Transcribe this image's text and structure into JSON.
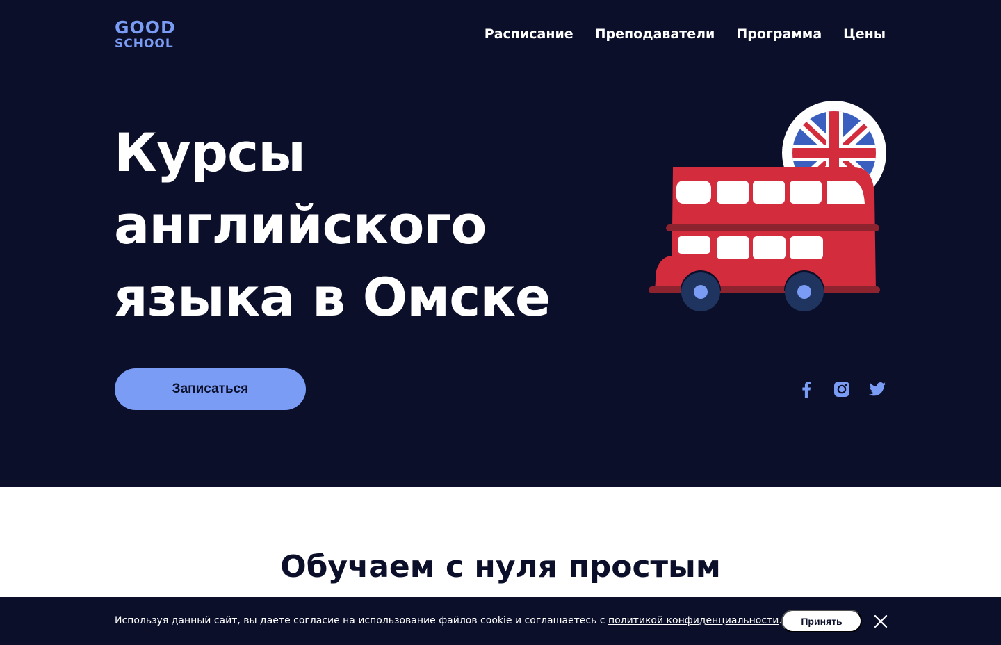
{
  "header": {
    "logo_line1": "GOOD",
    "logo_line2": "SCHOOL",
    "nav": [
      "Расписание",
      "Преподаватели",
      "Программа",
      "Цены"
    ]
  },
  "hero": {
    "title_lines": [
      "Курсы",
      "английского",
      "языка в Омске"
    ],
    "cta_label": "Записаться",
    "illustration_icons": [
      "union-jack-icon",
      "double-decker-bus-icon"
    ],
    "social_icons": [
      "facebook-icon",
      "instagram-icon",
      "twitter-icon"
    ]
  },
  "section": {
    "title": "Обучаем с нуля простым"
  },
  "cookie": {
    "text_before": "Используя данный сайт, вы даете согласие на использование файлов cookie и соглашаетесь с ",
    "link": "политикой конфиденциальности",
    "text_after": ".",
    "accept_label": "Принять",
    "close_icon": "close-icon"
  },
  "colors": {
    "background_dark": "#0b0f29",
    "accent": "#7b9cf5",
    "bus_red": "#d22c3d",
    "white": "#ffffff"
  }
}
